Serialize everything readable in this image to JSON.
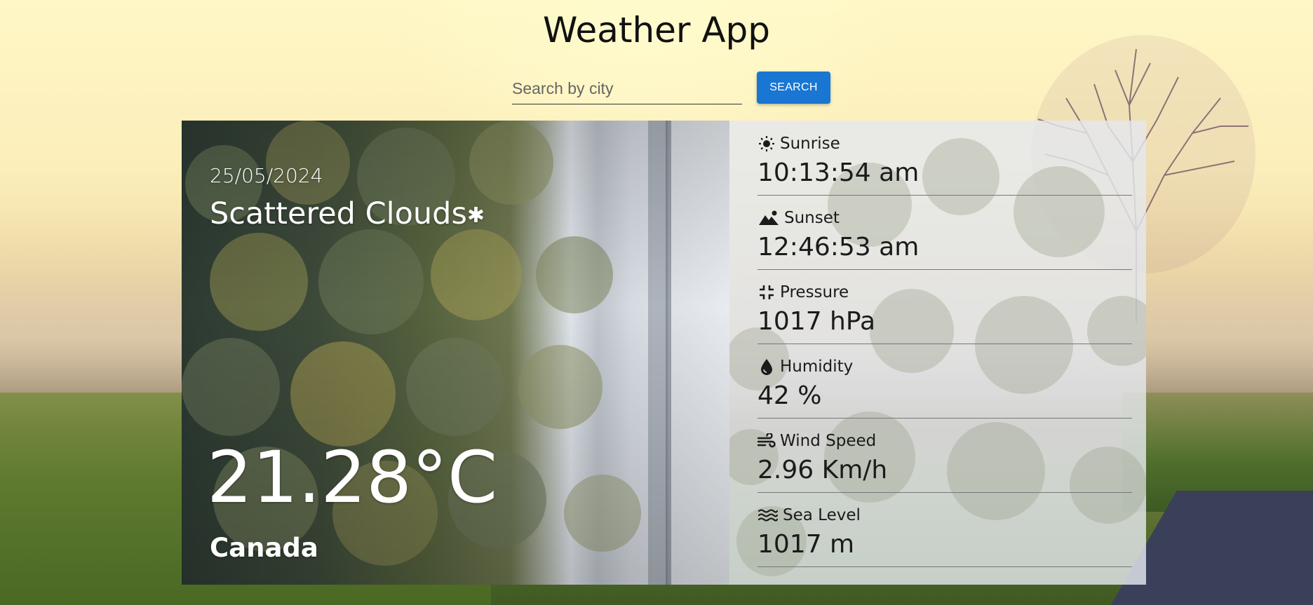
{
  "app": {
    "title": "Weather App"
  },
  "search": {
    "placeholder": "Search by city",
    "value": "",
    "button_label": "SEARCH"
  },
  "current": {
    "date": "25/05/2024",
    "condition": "Scattered Clouds",
    "condition_icon": "snowflake-icon",
    "temperature": "21.28°C",
    "location": "Canada"
  },
  "stats": [
    {
      "label": "Sunrise",
      "value": "10:13:54 am",
      "icon": "sun-icon"
    },
    {
      "label": "Sunset",
      "value": "12:46:53 am",
      "icon": "mountain-sun-icon"
    },
    {
      "label": "Pressure",
      "value": "1017 hPa",
      "icon": "compress-icon"
    },
    {
      "label": "Humidity",
      "value": "42 %",
      "icon": "droplet-icon"
    },
    {
      "label": "Wind Speed",
      "value": "2.96 Km/h",
      "icon": "wind-icon"
    },
    {
      "label": "Sea Level",
      "value": "1017 m",
      "icon": "water-icon"
    }
  ],
  "colors": {
    "accent": "#1976d2",
    "text_dark": "#1b1b1b",
    "text_light": "#ffffff"
  }
}
